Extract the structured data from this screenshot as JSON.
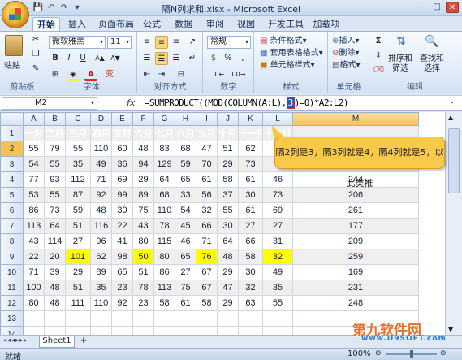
{
  "window": {
    "title": "隔N列求和.xlsx - Microsoft Excel",
    "controls": [
      "–",
      "□",
      "✕"
    ]
  },
  "qat": [
    "💾",
    "↶",
    "↷",
    "▾"
  ],
  "tabs": [
    "开始",
    "插入",
    "页面布局",
    "公式",
    "数据",
    "审阅",
    "视图",
    "开发工具",
    "加载项"
  ],
  "ribbon": {
    "clipboard": {
      "label": "剪贴板",
      "paste": "粘贴"
    },
    "font": {
      "label": "字体",
      "name": "微软雅黑",
      "size": "11",
      "b": "B",
      "i": "I",
      "u": "U",
      "grow": "A▲",
      "shrink": "A▼",
      "color_a": "A",
      "wen": "变"
    },
    "align": {
      "label": "对齐方式"
    },
    "number": {
      "label": "数字",
      "format": "常规",
      "pct": "%",
      "comma": ",",
      "curr": "$"
    },
    "styles": {
      "label": "样式",
      "items": [
        "条件格式",
        "套用表格格式",
        "单元格样式"
      ]
    },
    "cells": {
      "label": "单元格",
      "items": [
        "插入",
        "删除",
        "格式"
      ]
    },
    "edit": {
      "label": "编辑",
      "sort": "排序和\n筛选",
      "find": "查找和\n选择",
      "sigma": "Σ"
    }
  },
  "namebox": "M2",
  "fx": "fx",
  "formula": {
    "before": "=SUMPRODUCT((MOD(COLUMN(A:L),",
    "highlight": "3",
    "after": ")=0)*A2:L2)"
  },
  "columns": [
    "A",
    "B",
    "C",
    "D",
    "E",
    "F",
    "G",
    "H",
    "I",
    "J",
    "K",
    "L",
    "M"
  ],
  "rows": [
    [
      "一月",
      "二月",
      "三月",
      "四月",
      "五月",
      "六月",
      "七月",
      "八月",
      "九月",
      "十月",
      "十一月",
      "十二月",
      ""
    ],
    [
      "55",
      "79",
      "55",
      "110",
      "60",
      "48",
      "83",
      "68",
      "47",
      "51",
      "62",
      "",
      ""
    ],
    [
      "54",
      "55",
      "35",
      "49",
      "36",
      "94",
      "129",
      "59",
      "70",
      "29",
      "73",
      "",
      ""
    ],
    [
      "77",
      "93",
      "112",
      "71",
      "69",
      "29",
      "64",
      "65",
      "61",
      "58",
      "61",
      "46",
      "244"
    ],
    [
      "53",
      "55",
      "87",
      "92",
      "99",
      "89",
      "68",
      "33",
      "56",
      "37",
      "30",
      "73",
      "206"
    ],
    [
      "86",
      "73",
      "59",
      "48",
      "30",
      "75",
      "110",
      "54",
      "32",
      "55",
      "61",
      "69",
      "261"
    ],
    [
      "113",
      "64",
      "51",
      "116",
      "22",
      "43",
      "78",
      "45",
      "66",
      "30",
      "27",
      "27",
      "177"
    ],
    [
      "43",
      "114",
      "27",
      "96",
      "41",
      "80",
      "115",
      "46",
      "71",
      "64",
      "66",
      "31",
      "209"
    ],
    [
      "22",
      "20",
      "101",
      "62",
      "98",
      "50",
      "80",
      "65",
      "76",
      "48",
      "58",
      "32",
      "259"
    ],
    [
      "71",
      "39",
      "29",
      "89",
      "65",
      "51",
      "86",
      "27",
      "67",
      "29",
      "30",
      "49",
      "169"
    ],
    [
      "100",
      "48",
      "51",
      "35",
      "23",
      "78",
      "113",
      "75",
      "67",
      "47",
      "32",
      "35",
      "231"
    ],
    [
      "80",
      "48",
      "111",
      "110",
      "92",
      "23",
      "58",
      "61",
      "58",
      "29",
      "63",
      "55",
      "248"
    ]
  ],
  "highlights": [
    [
      8,
      2
    ],
    [
      8,
      5
    ],
    [
      8,
      8
    ],
    [
      8,
      11
    ]
  ],
  "callout": "隔2列是3，隔3列就是4，隔4列就是5，以此类推",
  "sheet": {
    "tab": "Sheet1",
    "nav": [
      "◂◂",
      "◂",
      "▸",
      "▸▸"
    ]
  },
  "status": {
    "ready": "就绪",
    "zoom": "100%"
  },
  "watermark": {
    "main": "第九软件网",
    "sub": "www.D9SOFT.com"
  }
}
